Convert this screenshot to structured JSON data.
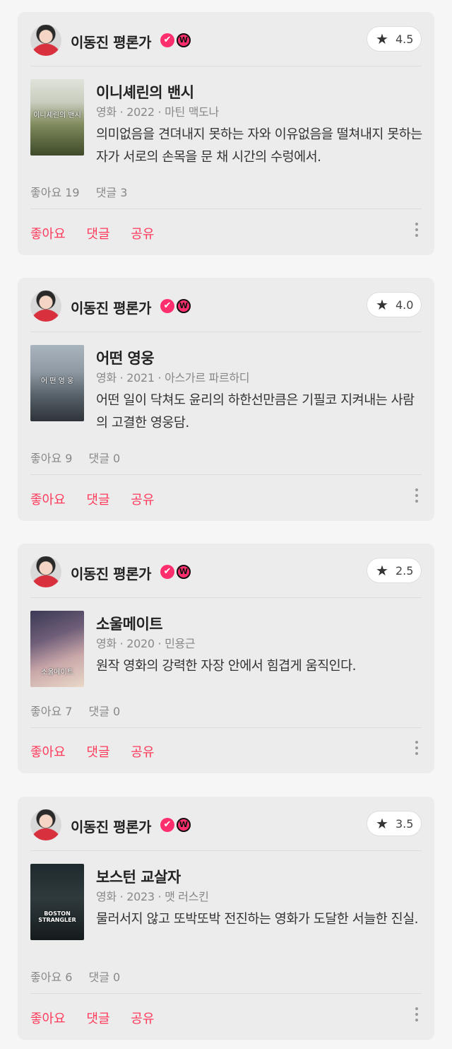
{
  "feed": {
    "reviews": [
      {
        "author": "이동진 평론가",
        "verified_badge": "✔",
        "w_badge": "W",
        "rating": "4.5",
        "movie_title": "이니셰린의 밴시",
        "meta": "영화 · 2022 · 마틴 맥도나",
        "poster_text": "이니셰린의 밴시",
        "text": "의미없음을 견뎌내지 못하는 자와 이유없음을 떨쳐내지 못하는 자가 서로의 손목을 문 채 시간의 수렁에서.",
        "likes": "좋아요 19",
        "comments": "댓글 3",
        "actions": {
          "like": "좋아요",
          "comment": "댓글",
          "share": "공유"
        }
      },
      {
        "author": "이동진 평론가",
        "verified_badge": "✔",
        "w_badge": "W",
        "rating": "4.0",
        "movie_title": "어떤 영웅",
        "meta": "영화 · 2021 · 아스가르 파르하디",
        "poster_text": "어 떤 영 웅",
        "text": "어떤 일이 닥쳐도 윤리의 하한선만큼은 기필코 지켜내는 사람의 고결한 영웅담.",
        "likes": "좋아요 9",
        "comments": "댓글 0",
        "actions": {
          "like": "좋아요",
          "comment": "댓글",
          "share": "공유"
        }
      },
      {
        "author": "이동진 평론가",
        "verified_badge": "✔",
        "w_badge": "W",
        "rating": "2.5",
        "movie_title": "소울메이트",
        "meta": "영화 · 2020 · 민용근",
        "poster_text": "소울메이트",
        "text": "원작 영화의 강력한 자장 안에서 힘겹게 움직인다.",
        "likes": "좋아요 7",
        "comments": "댓글 0",
        "actions": {
          "like": "좋아요",
          "comment": "댓글",
          "share": "공유"
        }
      },
      {
        "author": "이동진 평론가",
        "verified_badge": "✔",
        "w_badge": "W",
        "rating": "3.5",
        "movie_title": "보스턴 교살자",
        "meta": "영화 · 2023 · 맷 러스킨",
        "poster_text": "BOSTON STRANGLER",
        "text": "물러서지 않고 또박또박 전진하는 영화가 도달한 서늘한 진실.",
        "likes": "좋아요 6",
        "comments": "댓글 0",
        "actions": {
          "like": "좋아요",
          "comment": "댓글",
          "share": "공유"
        }
      }
    ]
  },
  "icons": {
    "star": "star-icon",
    "more": "more-vertical-icon"
  },
  "colors": {
    "accent": "#ff3a5b",
    "badge": "#ff2f6e",
    "card_bg": "#ececec"
  }
}
